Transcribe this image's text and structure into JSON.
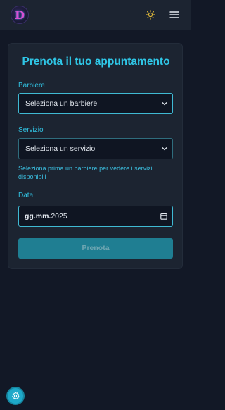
{
  "header": {
    "logo_letter": "D",
    "theme_icon": "sun-icon",
    "menu_icon": "hamburger-menu-icon"
  },
  "form": {
    "title": "Prenota il tuo appuntamento",
    "barber": {
      "label": "Barbiere",
      "selected": "Seleziona un barbiere"
    },
    "service": {
      "label": "Servizio",
      "selected": "Seleziona un servizio",
      "hint": "Seleziona prima un barbiere per vedere i servizi disponibili"
    },
    "date": {
      "label": "Data",
      "value_placeholder": "gg.mm.",
      "value_year": "2025"
    },
    "submit_label": "Prenota"
  },
  "floating": {
    "icon": "settings-gear-icon"
  },
  "colors": {
    "accent": "#2fc6e6",
    "background": "#121826",
    "card": "#1c2431",
    "button": "#1f7e92"
  }
}
